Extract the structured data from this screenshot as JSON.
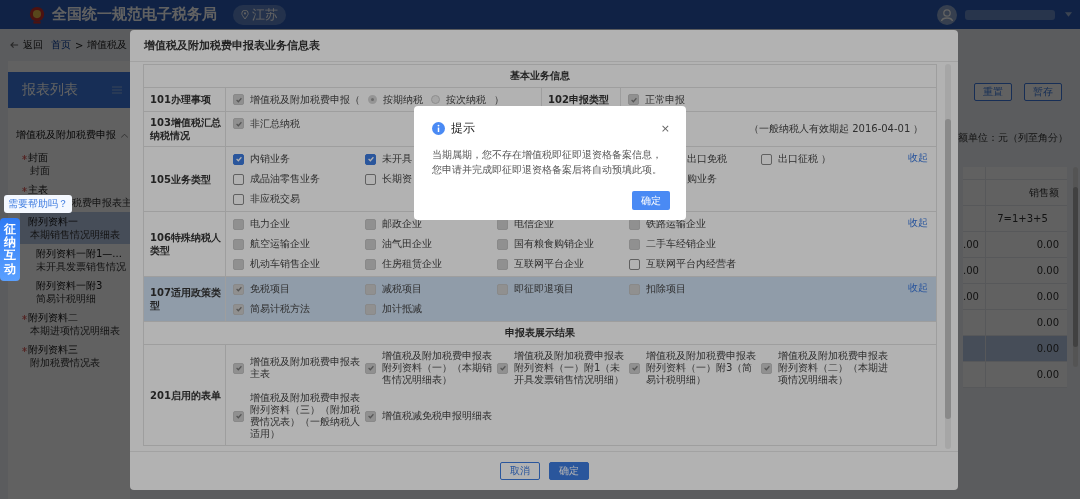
{
  "header": {
    "title": "全国统一规范电子税务局",
    "region": "江苏"
  },
  "breadcrumb": {
    "back": "返回",
    "items": [
      "首页",
      "增值税及"
    ],
    "separator": ">"
  },
  "sidebar": {
    "title": "报表列表",
    "group": {
      "label": "增值税及附加税费申报",
      "expanded": true,
      "items": [
        {
          "label": "封面",
          "sub": "封面",
          "required": true,
          "selected": false
        },
        {
          "label": "主表",
          "sub": "税费申报表主",
          "required": true,
          "selected": false
        },
        {
          "label": "附列资料一",
          "sub": "本期销售情况明细表",
          "required": false,
          "selected": true,
          "children": [
            {
              "label": "附列资料一附1—...",
              "sub": "未开具发票销售情况",
              "required": false,
              "selected": false
            },
            {
              "label": "附列资料一附3",
              "sub": "简易计税明细",
              "required": false,
              "selected": false
            }
          ]
        },
        {
          "label": "附列资料二",
          "sub": "本期进项情况明细表",
          "required": true,
          "selected": false
        },
        {
          "label": "附列资料三",
          "sub": "附加税费情况表",
          "required": true,
          "selected": false
        }
      ]
    }
  },
  "toolbar": {
    "buttons": [
      "重置",
      "暂存"
    ]
  },
  "unit_note": "额单位：元（列至角分）",
  "table": {
    "column": {
      "header": "销售额",
      "formula": "7=1+3+5"
    },
    "rows": [
      {
        "cut": ".00",
        "value": "0.00",
        "selected": false
      },
      {
        "cut": ".00",
        "value": "0.00",
        "selected": false
      },
      {
        "cut": ".00",
        "value": "0.00",
        "selected": false
      },
      {
        "value": "0.00",
        "selected": false
      },
      {
        "value": "0.00",
        "selected": true
      },
      {
        "value": "0.00",
        "selected": false
      }
    ]
  },
  "modal": {
    "title": "增值税及附加税费申报表业务信息表",
    "sections": [
      {
        "title": "基本业务信息",
        "rows": [
          {
            "kind": "pair",
            "label": "101办理事项",
            "value": [
              {
                "kind": "checkbox",
                "text": "增值税及附加税费申报（",
                "checked": true,
                "disabled": true
              },
              {
                "kind": "radio",
                "text": "按期纳税",
                "selected": true
              },
              {
                "kind": "radio",
                "text": "按次纳税",
                "selected": false
              },
              {
                "kind": "text",
                "text": "）"
              }
            ],
            "label2": "102申报类型",
            "value2": [
              {
                "kind": "checkbox",
                "text": "正常申报",
                "checked": true,
                "disabled": true
              }
            ]
          },
          {
            "kind": "pair",
            "label": "103增值税汇总纳税情况",
            "value": [
              {
                "kind": "checkbox",
                "text": "非汇总纳税",
                "checked": true,
                "disabled": true
              }
            ],
            "value2": [
              {
                "kind": "fragment",
                "text": "（一般纳税人有效期起 2016-04-01 ）"
              }
            ]
          },
          {
            "kind": "options",
            "label": "105业务类型",
            "collapse": "收起",
            "highlighted": false,
            "lines": [
              [
                {
                  "kind": "checkbox",
                  "text": "内销业务",
                  "checked": true,
                  "disabled": false
                },
                {
                  "kind": "checkbox",
                  "text": "未开具",
                  "checked": true,
                  "disabled": false
                },
                {
                  "kind": "blank"
                },
                {
                  "kind": "fragment",
                  "text": "出口免税"
                },
                {
                  "kind": "checkbox",
                  "text": "出口征税 ）",
                  "checked": false,
                  "disabled": false
                }
              ],
              [
                {
                  "kind": "checkbox",
                  "text": "成品油零售业务",
                  "checked": false,
                  "disabled": false
                },
                {
                  "kind": "checkbox",
                  "text": "长期资",
                  "checked": false,
                  "disabled": false
                },
                {
                  "kind": "blank"
                },
                {
                  "kind": "fragment",
                  "text": "购业务"
                }
              ],
              [
                {
                  "kind": "checkbox",
                  "text": "非应税交易",
                  "checked": false,
                  "disabled": false
                }
              ]
            ]
          },
          {
            "kind": "options",
            "label": "106特殊纳税人类型",
            "collapse": "收起",
            "highlighted": false,
            "lines": [
              [
                {
                  "kind": "checkbox",
                  "text": "电力企业",
                  "checked": false,
                  "disabled": true
                },
                {
                  "kind": "checkbox",
                  "text": "邮政企业",
                  "checked": false,
                  "disabled": true
                },
                {
                  "kind": "checkbox",
                  "text": "电信企业",
                  "checked": false,
                  "disabled": true
                },
                {
                  "kind": "checkbox",
                  "text": "铁路运输企业",
                  "checked": false,
                  "disabled": true
                }
              ],
              [
                {
                  "kind": "checkbox",
                  "text": "航空运输企业",
                  "checked": false,
                  "disabled": true
                },
                {
                  "kind": "checkbox",
                  "text": "油气田企业",
                  "checked": false,
                  "disabled": true
                },
                {
                  "kind": "checkbox",
                  "text": "国有粮食购销企业",
                  "checked": false,
                  "disabled": true
                },
                {
                  "kind": "checkbox",
                  "text": "二手车经销企业",
                  "checked": false,
                  "disabled": true
                }
              ],
              [
                {
                  "kind": "checkbox",
                  "text": "机动车销售企业",
                  "checked": false,
                  "disabled": true
                },
                {
                  "kind": "checkbox",
                  "text": "住房租赁企业",
                  "checked": false,
                  "disabled": true
                },
                {
                  "kind": "checkbox",
                  "text": "互联网平台企业",
                  "checked": false,
                  "disabled": true
                },
                {
                  "kind": "checkbox",
                  "text": "互联网平台内经营者",
                  "checked": false,
                  "disabled": false
                }
              ]
            ]
          },
          {
            "kind": "options",
            "label": "107适用政策类型",
            "collapse": "收起",
            "highlighted": true,
            "lines": [
              [
                {
                  "kind": "checkbox",
                  "text": "免税项目",
                  "checked": true,
                  "disabled": true
                },
                {
                  "kind": "checkbox",
                  "text": "减税项目",
                  "checked": false,
                  "disabled": true
                },
                {
                  "kind": "checkbox",
                  "text": "即征即退项目",
                  "checked": false,
                  "disabled": true
                },
                {
                  "kind": "checkbox",
                  "text": "扣除项目",
                  "checked": false,
                  "disabled": true
                }
              ],
              [
                {
                  "kind": "checkbox",
                  "text": "简易计税方法",
                  "checked": true,
                  "disabled": true
                },
                {
                  "kind": "checkbox",
                  "text": "加计抵减",
                  "checked": false,
                  "disabled": true
                }
              ]
            ]
          }
        ]
      },
      {
        "title": "申报表展示结果",
        "rows": [
          {
            "kind": "options",
            "label": "201启用的表单",
            "highlighted": false,
            "lines": [
              [
                {
                  "kind": "checkbox",
                  "text": "增值税及附加税费申报表主表",
                  "checked": true,
                  "disabled": true
                },
                {
                  "kind": "checkbox",
                  "text": "增值税及附加税费申报表附列资料（一）（本期销售情况明细表）",
                  "checked": true,
                  "disabled": true
                },
                {
                  "kind": "checkbox",
                  "text": "增值税及附加税费申报表附列资料（一）附1（未开具发票销售情况明细）",
                  "checked": true,
                  "disabled": true
                },
                {
                  "kind": "checkbox",
                  "text": "增值税及附加税费申报表附列资料（一）附3（简易计税明细）",
                  "checked": true,
                  "disabled": true
                },
                {
                  "kind": "checkbox",
                  "text": "增值税及附加税费申报表附列资料（二）（本期进项情况明细表）",
                  "checked": true,
                  "disabled": true
                }
              ],
              [
                {
                  "kind": "checkbox",
                  "text": "增值税及附加税费申报表附列资料（三）（附加税费情况表）（一般纳税人适用）",
                  "checked": true,
                  "disabled": true
                },
                {
                  "kind": "checkbox",
                  "text": "增值税减免税申报明细表",
                  "checked": true,
                  "disabled": true
                }
              ]
            ]
          }
        ]
      }
    ],
    "buttons": [
      {
        "label": "取消",
        "kind": "secondary"
      },
      {
        "label": "确定",
        "kind": "primary"
      }
    ]
  },
  "dialog": {
    "title": "提示",
    "close": "×",
    "message": "当期属期，您不存在增值税即征即退资格备案信息，您申请并完成即征即退资格备案后将自动预填此项。",
    "button": "确定"
  },
  "widget": {
    "bubble": "需要帮助吗？",
    "label": "征纳互动"
  }
}
